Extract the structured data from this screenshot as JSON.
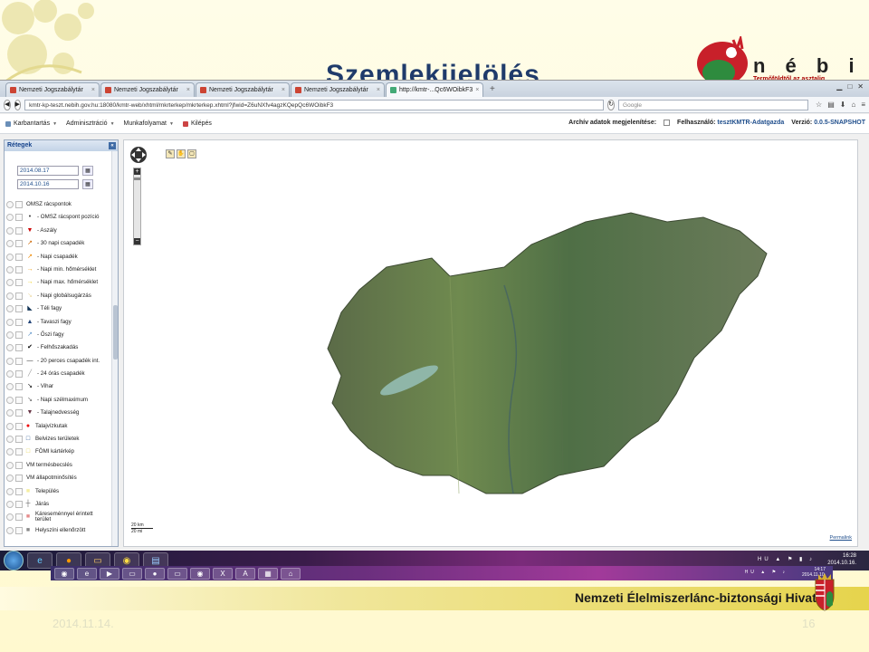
{
  "slide": {
    "title": "Szemlekijelölés",
    "logo_text": "n é b i h",
    "logo_sub": "Termőföldtől az asztalig",
    "footer_org": "Nemzeti Élelmiszerlánc-biztonsági Hivatal",
    "date": "2014.11.14.",
    "page_number": "16"
  },
  "browser": {
    "tabs": [
      {
        "label": "Nemzeti Jogszabálytár"
      },
      {
        "label": "Nemzeti Jogszabálytár"
      },
      {
        "label": "Nemzeti Jogszabálytár"
      },
      {
        "label": "Nemzeti Jogszabálytár"
      },
      {
        "label": "http://kmtr-...Qc6WOibkF3"
      }
    ],
    "new_tab": "+",
    "url": "kmtr-kp-teszt.nebih.gov.hu:18080/kmtr-web/xhtml/mkrterkep/mkrterkep.xhtml?jfwid=Z6uNXfv4agzKQepQc6WOibkF3",
    "search_placeholder": "Google"
  },
  "app": {
    "menu": [
      "Karbantartás",
      "Adminisztráció",
      "Munkafolyamat",
      "Kilépés"
    ],
    "archive_label": "Archív adatok megjelenítése:",
    "user_label": "Felhasználó:",
    "user_value": "tesztKMTR-Adatgazda",
    "version_label": "Verzió:",
    "version_value": "0.0.5-SNAPSHOT"
  },
  "sidebar": {
    "title": "Rétegek",
    "date_from": "2014.08.17",
    "date_to": "2014.10.16",
    "layers": [
      {
        "label": "OMSZ rácspontok",
        "indent": 0,
        "symbol": "",
        "color": "#333"
      },
      {
        "label": "- OMSZ rácspont pozíció",
        "indent": 1,
        "symbol": "•",
        "color": "#333"
      },
      {
        "label": "- Aszály",
        "indent": 1,
        "symbol": "▼",
        "color": "#c00"
      },
      {
        "label": "- 30 napi csapadék",
        "indent": 1,
        "symbol": "↗",
        "color": "#c60"
      },
      {
        "label": "- Napi csapadék",
        "indent": 1,
        "symbol": "↗",
        "color": "#e80"
      },
      {
        "label": "- Napi min. hőmérséklet",
        "indent": 1,
        "symbol": "→",
        "color": "#e90"
      },
      {
        "label": "- Napi max. hőmérséklet",
        "indent": 1,
        "symbol": "→",
        "color": "#ec0"
      },
      {
        "label": "- Napi globálsugárzás",
        "indent": 1,
        "symbol": "↘",
        "color": "#eda"
      },
      {
        "label": "- Téli fagy",
        "indent": 1,
        "symbol": "◣",
        "color": "#135"
      },
      {
        "label": "- Tavaszi fagy",
        "indent": 1,
        "symbol": "▲",
        "color": "#247"
      },
      {
        "label": "- Őszi fagy",
        "indent": 1,
        "symbol": "↗",
        "color": "#69c"
      },
      {
        "label": "- Felhőszakadás",
        "indent": 1,
        "symbol": "✔",
        "color": "#000"
      },
      {
        "label": "- 20 perces csapadék int.",
        "indent": 1,
        "symbol": "—",
        "color": "#333"
      },
      {
        "label": "- 24 órás csapadék",
        "indent": 1,
        "symbol": "╱",
        "color": "#999"
      },
      {
        "label": "- Vihar",
        "indent": 1,
        "symbol": "↘",
        "color": "#000"
      },
      {
        "label": "- Napi szélmaximum",
        "indent": 1,
        "symbol": "↘",
        "color": "#666"
      },
      {
        "label": "- Talajnedvesség",
        "indent": 1,
        "symbol": "▼",
        "color": "#634"
      },
      {
        "label": "Talajvízkutak",
        "indent": 0,
        "symbol": "●",
        "color": "#e00"
      },
      {
        "label": "Belvizes területek",
        "indent": 0,
        "symbol": "□",
        "color": "#1f4e8c"
      },
      {
        "label": "FÖMI kártérkép",
        "indent": 0,
        "symbol": "□",
        "color": "#e7d34a"
      },
      {
        "label": "VM termésbecslés",
        "indent": 0,
        "symbol": "",
        "color": "#333"
      },
      {
        "label": "VM állapotminősítés",
        "indent": 0,
        "symbol": "",
        "color": "#333"
      },
      {
        "label": "Település",
        "indent": 0,
        "symbol": "■",
        "color": "#f5eea0"
      },
      {
        "label": "Járás",
        "indent": 0,
        "symbol": "┼",
        "color": "#555"
      },
      {
        "label": "Káreseménnyel érintett terület",
        "indent": 0,
        "symbol": "■",
        "color": "#e58c8c"
      },
      {
        "label": "Helyszíni ellenőrzött",
        "indent": 0,
        "symbol": "■",
        "color": "#888"
      }
    ]
  },
  "map": {
    "scale_km": "20 km",
    "scale_mi": "20 mi",
    "permalink": "Permalink",
    "zoom_in": "+",
    "zoom_out": "−"
  },
  "taskbar": {
    "lang": "HU",
    "time": "16:28",
    "date": "2014.10.16.",
    "inner_lang": "HU",
    "inner_time": "14:17",
    "inner_date": "2014.11.10."
  },
  "colors": {
    "title": "#1f3b6b",
    "accent": "#1f4e8c",
    "footer_gold": "#e6d44c"
  }
}
